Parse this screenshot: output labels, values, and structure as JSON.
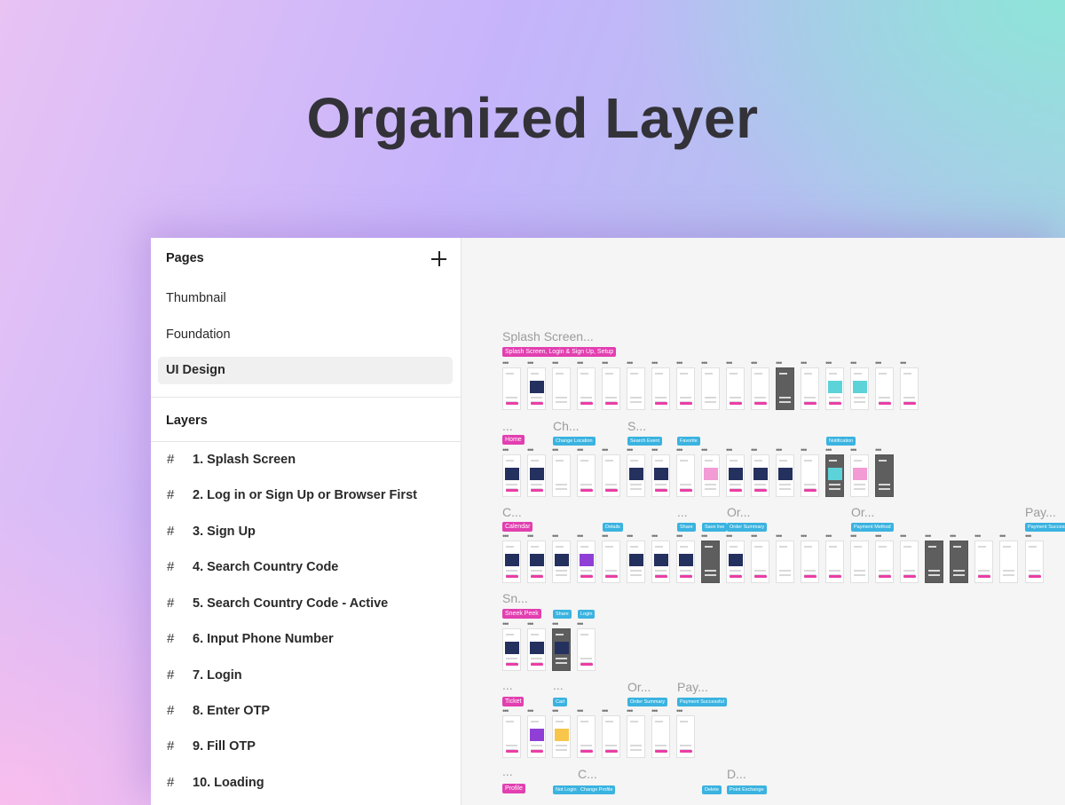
{
  "hero": {
    "title": "Organized Layer"
  },
  "sidebar": {
    "pages_header": "Pages",
    "pages": [
      {
        "label": "Thumbnail"
      },
      {
        "label": "Foundation"
      },
      {
        "label": "UI Design"
      }
    ],
    "active_page": "UI Design",
    "layers_header": "Layers",
    "layers": [
      {
        "label": "1. Splash Screen"
      },
      {
        "label": "2. Log in or Sign Up or Browser First"
      },
      {
        "label": "3. Sign Up"
      },
      {
        "label": "4. Search Country Code"
      },
      {
        "label": "5. Search Country Code - Active"
      },
      {
        "label": "6. Input Phone Number"
      },
      {
        "label": "7. Login"
      },
      {
        "label": "8. Enter OTP"
      },
      {
        "label": "9. Fill OTP"
      },
      {
        "label": "10. Loading"
      }
    ]
  },
  "canvas": {
    "labels": [
      "Splash Screen...",
      "...",
      "Ch...",
      "S...",
      "C...",
      "...",
      "Or...",
      "Or...",
      "Pay...",
      "Sn...",
      "...",
      "...",
      "Or...",
      "Pay...",
      "...",
      "C...",
      "D..."
    ],
    "tags": [
      "Splash Screen, Login & Sign Up, Setup",
      "Home",
      "Change Location",
      "Search Event",
      "Favorite",
      "Notification",
      "Calendar",
      "Details",
      "Share",
      "Save live",
      "Order Summary",
      "Payment Method",
      "Payment Successful",
      "Sneek Peek",
      "Share",
      "Login",
      "Ticket",
      "Cart",
      "Order Summary",
      "Payment Successful",
      "Profile",
      "Not Login",
      "Change Profile",
      "Delete",
      "Point Exchange"
    ]
  },
  "colors": {
    "pink_tag": "#e23fb0",
    "blue_tag": "#3ab3e0",
    "hero_text": "#333238"
  },
  "icons": {
    "add": "plus-icon",
    "frame": "hash-icon"
  }
}
